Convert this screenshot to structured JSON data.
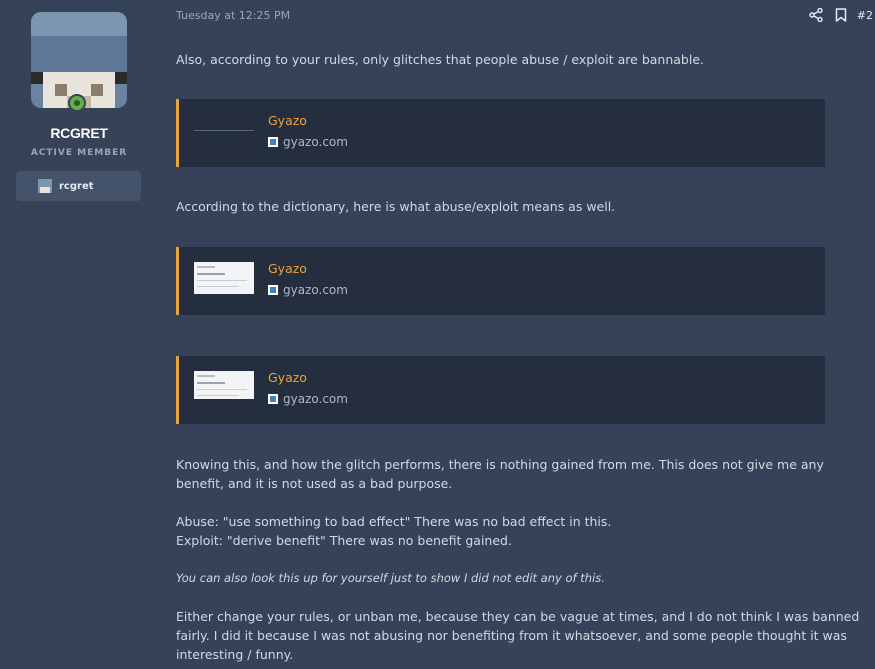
{
  "user": {
    "name": "RCGRET",
    "title": "ACTIVE MEMBER",
    "chip_name": "rcgret"
  },
  "post": {
    "date": "Tuesday at 12:25 PM",
    "number": "#2",
    "share_icon": "share-icon",
    "bookmark_icon": "bookmark-icon"
  },
  "body": {
    "p1": "Also, according to your rules, only glitches that people abuse / exploit are bannable.",
    "p2": "According to the dictionary, here is what abuse/exploit means as well.",
    "p3a": "Knowing this, and how the glitch performs, there is nothing gained from me. This does not give me any",
    "p3b": "benefit, and it is not used as a bad purpose.",
    "p4a": "Abuse: \"use something to bad effect\" There was no bad effect in this.",
    "p4b": "Exploit: \"derive benefit\" There was no benefit gained.",
    "p5": "You can also look this up for yourself just to show I did not edit any of this.",
    "p6a": "Either change your rules, or unban me, because they can be vague at times, and I do not think I was banned",
    "p6b": "fairly. I did it because I was not abusing nor benefiting from it whatsoever, and some people thought it was",
    "p6c": "interesting / funny."
  },
  "embeds": [
    {
      "title": "Gyazo",
      "site": "gyazo.com"
    },
    {
      "title": "Gyazo",
      "site": "gyazo.com"
    },
    {
      "title": "Gyazo",
      "site": "gyazo.com"
    }
  ],
  "colors": {
    "background": "#364257",
    "embed_bg": "#242e3f",
    "embed_accent": "#e8a33a",
    "link_orange": "#f0a23a",
    "online_green": "#63b04b"
  }
}
